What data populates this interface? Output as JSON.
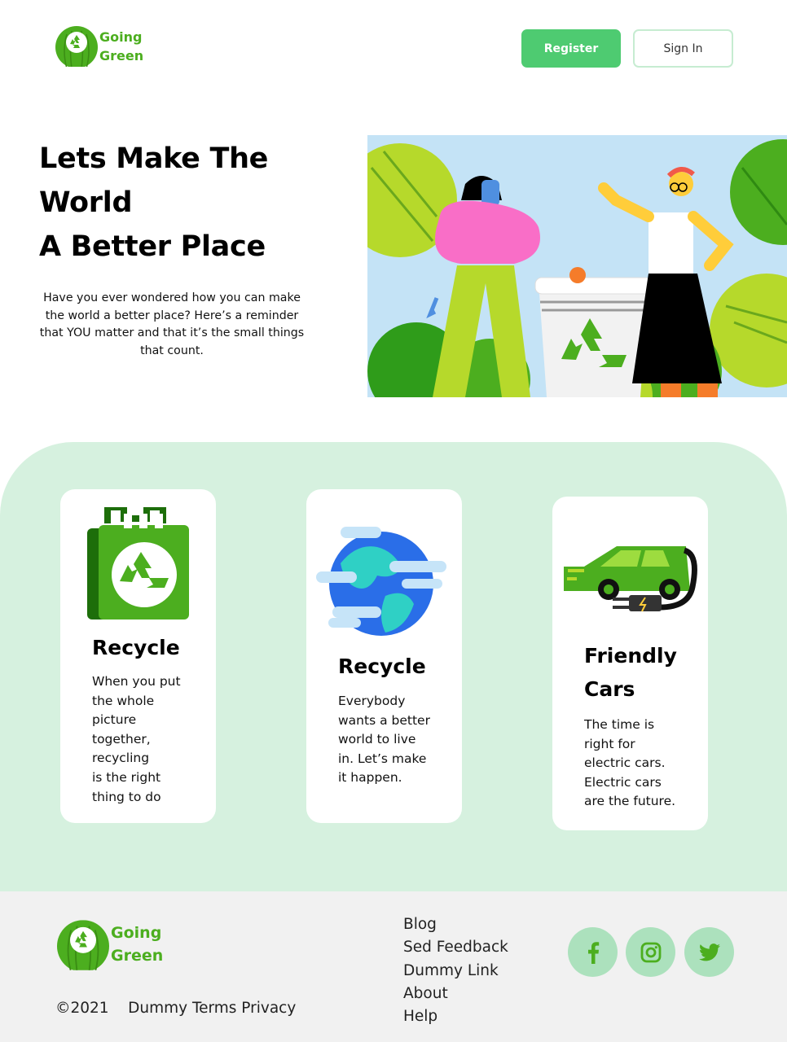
{
  "brand": {
    "line1": "Going",
    "line2": "Green",
    "color": "#4cae1f"
  },
  "header": {
    "register_label": "Register",
    "signin_label": "Sign In"
  },
  "hero": {
    "title_line1": "Lets Make The",
    "title_line2": "World",
    "title_line3": "A Better Place",
    "description": "Have you ever wondered how you can make the world a better place? Here’s a reminder that YOU matter and that it’s the small things that count.",
    "image": "people-recycling-illustration"
  },
  "features": [
    {
      "icon": "recycle-bag-icon",
      "title": "Recycle",
      "text": "When you put\nthe whole\npicture\ntogether,\nrecycling\n is the right\nthing to do"
    },
    {
      "icon": "globe-icon",
      "title": "Recycle",
      "text": "Everybody\nwants a better\nworld to live\nin. Let’s make\nit happen."
    },
    {
      "icon": "electric-car-icon",
      "title_line1": "Friendly",
      "title_line2": "Cars",
      "text": "The time is\nright for\nelectric cars.\nElectric cars\nare the future."
    }
  ],
  "footer": {
    "copyright": "©2021    Dummy Terms Privacy",
    "links": [
      "Blog",
      "Sed Feedback",
      "Dummy Link",
      "About",
      "Help"
    ],
    "social": [
      "facebook-icon",
      "instagram-icon",
      "twitter-icon"
    ]
  },
  "colors": {
    "accent": "#4ecb71",
    "band": "#d6f1df",
    "footer_bg": "#f1f1f1",
    "social_bg": "#ace1bd",
    "social_icon": "#4cae1f"
  }
}
